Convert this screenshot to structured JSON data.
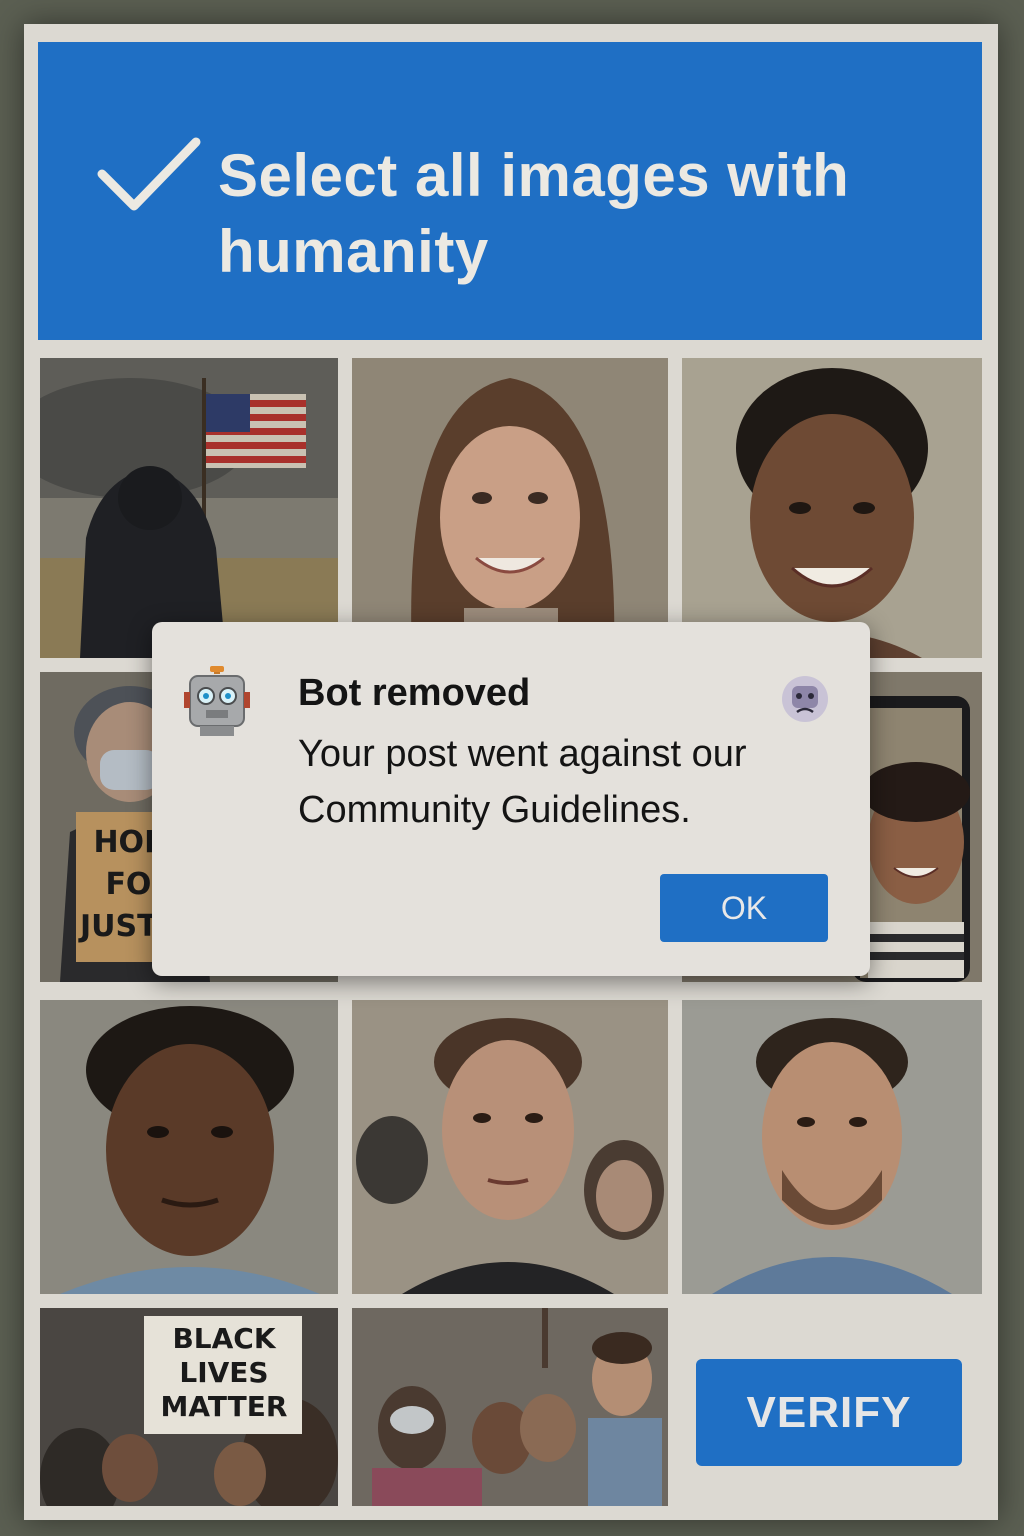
{
  "captcha": {
    "instruction": "Select all images with humanity",
    "verify_label": "VERIFY"
  },
  "tiles": [
    {
      "name": "tile-protest-flag"
    },
    {
      "name": "tile-smiling-woman"
    },
    {
      "name": "tile-smiling-woman-short-hair"
    },
    {
      "name": "tile-masked-protester-sign",
      "sign_text": "HOPE FOR JUSTICE"
    },
    {
      "name": "tile-selfie-phone"
    },
    {
      "name": "tile-man-portrait"
    },
    {
      "name": "tile-young-man-crowd"
    },
    {
      "name": "tile-bearded-man"
    },
    {
      "name": "tile-blm-sign",
      "sign_text": "BLACK LIVES MATTER"
    },
    {
      "name": "tile-protest-crowd"
    }
  ],
  "dialog": {
    "title": "Bot removed",
    "message": "Your post went against our Community Guidelines.",
    "ok_label": "OK",
    "icons": [
      "robot-icon",
      "sad-face-icon"
    ]
  },
  "colors": {
    "accent": "#1f6fc4",
    "panel": "#dcd9d2",
    "dialog_bg": "#e4e1dc"
  }
}
